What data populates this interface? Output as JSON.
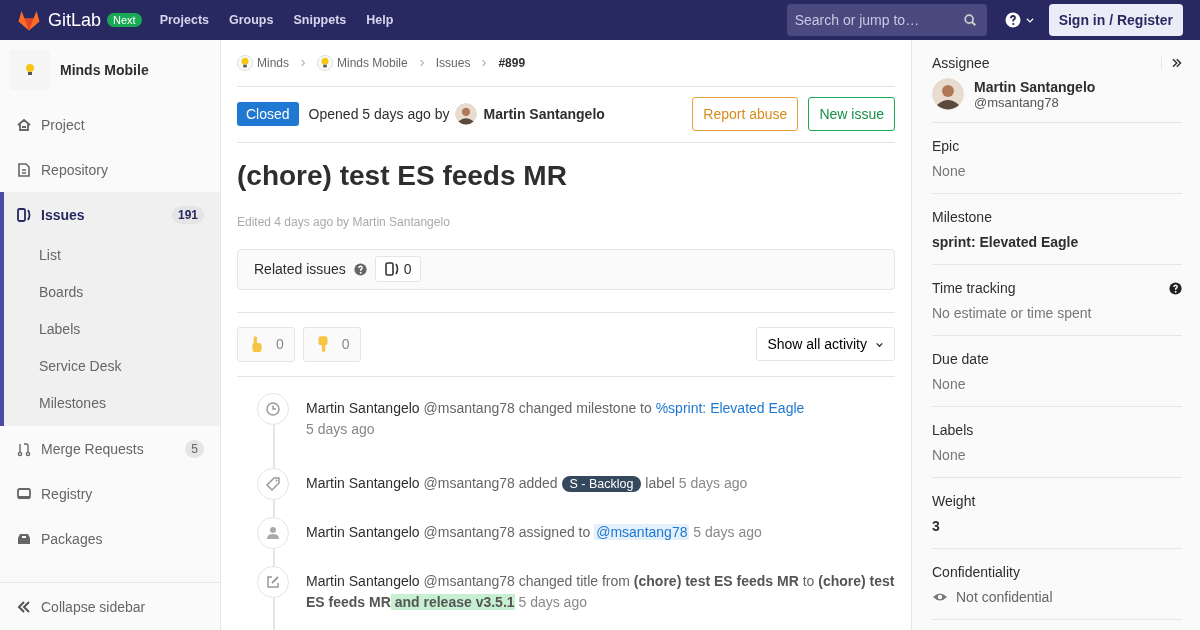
{
  "topbar": {
    "brand": "GitLab",
    "badge": "Next",
    "nav": [
      "Projects",
      "Groups",
      "Snippets",
      "Help"
    ],
    "search": {
      "placeholder": "Search or jump to…"
    },
    "sign_in": "Sign in / Register"
  },
  "sidebar": {
    "project": "Minds Mobile",
    "items": [
      {
        "label": "Project",
        "kind": "home",
        "selected": false
      },
      {
        "label": "Repository",
        "kind": "doc",
        "selected": false
      },
      {
        "label": "Issues",
        "kind": "issues",
        "badge": "191",
        "selected": true,
        "children": [
          {
            "label": "List"
          },
          {
            "label": "Boards"
          },
          {
            "label": "Labels"
          },
          {
            "label": "Service Desk"
          },
          {
            "label": "Milestones"
          }
        ]
      },
      {
        "label": "Merge Requests",
        "kind": "merge",
        "badge": "5",
        "selected": false
      },
      {
        "label": "Registry",
        "kind": "registry",
        "selected": false
      },
      {
        "label": "Packages",
        "kind": "package",
        "selected": false
      }
    ],
    "collapse": "Collapse sidebar"
  },
  "breadcrumbs": [
    {
      "label": "Minds",
      "kind": "avatar"
    },
    {
      "label": "Minds Mobile",
      "kind": "avatar"
    },
    {
      "label": "Issues",
      "kind": "plain"
    },
    {
      "label": "#899",
      "kind": "current"
    }
  ],
  "issue": {
    "status": "Closed",
    "opened": "Opened 5 days ago by",
    "author": "Martin Santangelo",
    "actions": [
      {
        "label": "Report abuse",
        "kind": "warning"
      },
      {
        "label": "New issue",
        "kind": "success"
      }
    ],
    "title": "(chore) test ES feeds MR",
    "edited": "Edited 4 days ago by Martin Santangelo",
    "related": {
      "label": "Related issues",
      "count": "0"
    },
    "awards": [
      {
        "kind": "thumbsup",
        "count": "0"
      },
      {
        "kind": "thumbsdown",
        "count": "0"
      }
    ],
    "filter": "Show all activity"
  },
  "activity": [
    {
      "kind": "milestone",
      "parts": [
        {
          "kind": "author",
          "text": "Martin Santangelo"
        },
        {
          "kind": "text",
          "text": " @msantang78 changed milestone to "
        },
        {
          "kind": "link",
          "text": "%sprint: Elevated Eagle"
        },
        {
          "kind": "time_block",
          "text": "5 days ago"
        }
      ]
    },
    {
      "kind": "label",
      "parts": [
        {
          "kind": "author",
          "text": "Martin Santangelo"
        },
        {
          "kind": "text",
          "text": " @msantang78 added "
        },
        {
          "kind": "label",
          "text": "S - Backlog"
        },
        {
          "kind": "text",
          "text": " label "
        },
        {
          "kind": "time",
          "text": "5 days ago"
        }
      ]
    },
    {
      "kind": "assignee",
      "parts": [
        {
          "kind": "author",
          "text": "Martin Santangelo"
        },
        {
          "kind": "text",
          "text": " @msantang78 assigned to "
        },
        {
          "kind": "mention",
          "text": "@msantang78"
        },
        {
          "kind": "time",
          "text": " 5 days ago"
        }
      ]
    },
    {
      "kind": "title",
      "parts": [
        {
          "kind": "author",
          "text": "Martin Santangelo"
        },
        {
          "kind": "text",
          "text": " @msantang78 changed title from "
        },
        {
          "kind": "bold",
          "text": "(chore) test ES feeds MR"
        },
        {
          "kind": "text",
          "text": " to "
        },
        {
          "kind": "bold",
          "text": "(chore) test ES feeds MR"
        },
        {
          "kind": "added",
          "text": " and release v3.5.1"
        },
        {
          "kind": "time",
          "text": " 5 days ago"
        }
      ]
    }
  ],
  "details": {
    "assignee": {
      "label": "Assignee",
      "name": "Martin Santangelo",
      "handle": "@msantang78"
    },
    "sections": [
      {
        "label": "Epic",
        "value": "None",
        "kind": "muted"
      },
      {
        "label": "Milestone",
        "value": "sprint: Elevated Eagle",
        "kind": "bold"
      },
      {
        "label": "Time tracking",
        "value": "No estimate or time spent",
        "kind": "muted",
        "help": true
      },
      {
        "label": "Due date",
        "value": "None",
        "kind": "muted"
      },
      {
        "label": "Labels",
        "value": "None",
        "kind": "muted"
      },
      {
        "label": "Weight",
        "value": "3",
        "kind": "bold"
      },
      {
        "label": "Confidentiality",
        "value": "Not confidential",
        "kind": "confidential"
      }
    ]
  }
}
